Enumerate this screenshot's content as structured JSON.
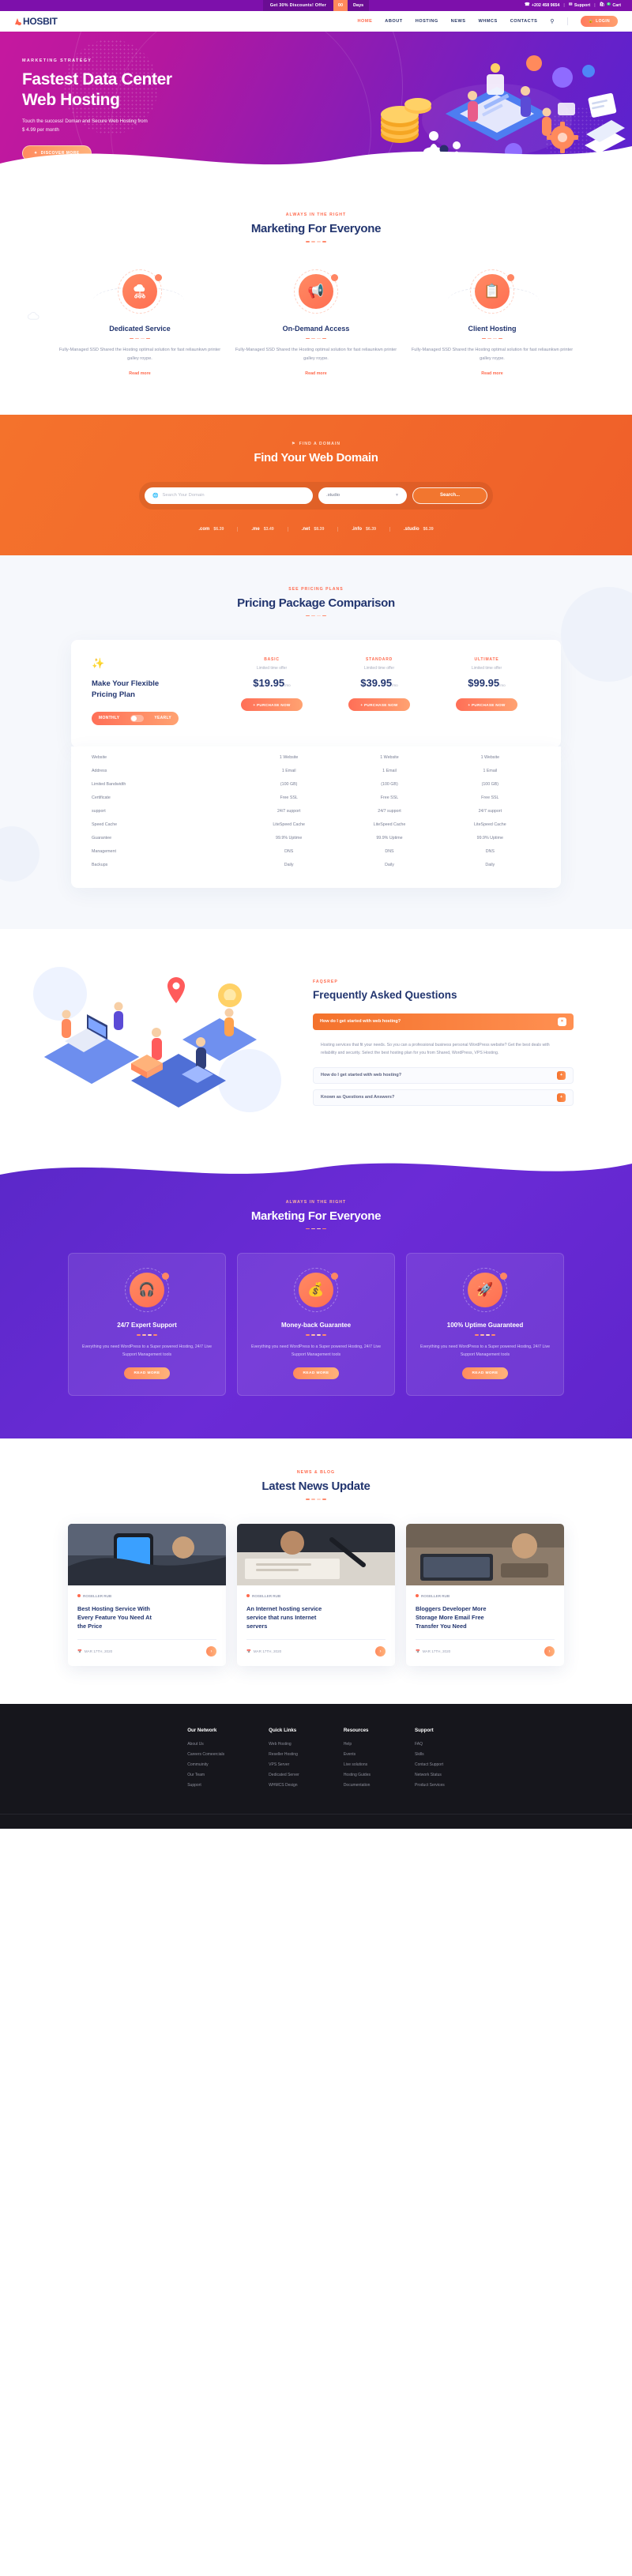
{
  "topbar": {
    "promo": "Get 30% Discounts! Offer",
    "counter": "00",
    "days": "Days",
    "phone": "+202 458 9654",
    "support": "Support",
    "cart": "Cart",
    "cart_count": "0"
  },
  "nav": {
    "logo": "HOSBIT",
    "items": [
      {
        "label": "HOME",
        "active": true
      },
      {
        "label": "ABOUT",
        "active": false
      },
      {
        "label": "HOSTING",
        "active": false
      },
      {
        "label": "NEWS",
        "active": false
      },
      {
        "label": "WHMCS",
        "active": false
      },
      {
        "label": "CONTACTS",
        "active": false
      }
    ],
    "login": "LOGIN"
  },
  "hero": {
    "eyebrow": "MARKETING STRATEGY",
    "title_line1": "Fastest Data Center",
    "title_line2": "Web Hosting",
    "sub_line1": "Touch the success! Doman and Secure Web Hosting from",
    "sub_line2": "$ 4.99 per month",
    "cta": "DISCOVER MORE"
  },
  "services": {
    "eyebrow": "ALWAYS IN THE RIGHT",
    "title": "Marketing For Everyone",
    "items": [
      {
        "icon": "cloud-network-icon",
        "title": "Dedicated Service",
        "text": "Fully-Managed SSD Shared the Hosting optimal solution for fast reliaunkwn printer galley roype.",
        "link": "Read more"
      },
      {
        "icon": "megaphone-icon",
        "title": "On-Demand Access",
        "text": "Fully-Managed SSD Shared the Hosting optimal solution for fast reliaunkwn printer galley roype.",
        "link": "Read more"
      },
      {
        "icon": "clipboard-icon",
        "title": "Client Hosting",
        "text": "Fully-Managed SSD Shared the Hosting optimal solution for fast reliaunkwn printer galley roype.",
        "link": "Read more"
      }
    ]
  },
  "domain": {
    "eyebrow": "FIND A DOMAIN",
    "title": "Find Your Web Domain",
    "search_placeholder": "Search Your Domain",
    "select_value": ".studio",
    "search_button": "Search...",
    "tlds": [
      {
        "name": ".com",
        "price": "$6.39"
      },
      {
        "name": ".me",
        "price": "$3.49"
      },
      {
        "name": ".net",
        "price": "$8.39"
      },
      {
        "name": ".info",
        "price": "$6.39"
      },
      {
        "name": ".studio",
        "price": "$6.39"
      }
    ]
  },
  "pricing": {
    "eyebrow": "SEE PRICING PLANS",
    "title": "Pricing Package Comparison",
    "panel_title_line1": "Make Your Flexible",
    "panel_title_line2": "Pricing Plan",
    "toggle_left": "MONTHLY",
    "toggle_right": "YEARLY",
    "plans": [
      {
        "name": "BASIC",
        "offer": "Limited time offer",
        "price": "$19.95",
        "per": "/mo",
        "cta": "+ PURCHASE NOW"
      },
      {
        "name": "STANDARD",
        "offer": "Limited time offer",
        "price": "$39.95",
        "per": "/mo",
        "cta": "+ PURCHASE NOW"
      },
      {
        "name": "ULTIMATE",
        "offer": "Limited time offer",
        "price": "$99.95",
        "per": "/mo",
        "cta": "+ PURCHASE NOW"
      }
    ],
    "rows": [
      {
        "label": "Website",
        "values": [
          "1 Website",
          "1 Website",
          "1 Website"
        ]
      },
      {
        "label": "Address",
        "values": [
          "1 Email",
          "1 Email",
          "1 Email"
        ]
      },
      {
        "label": "Limited Bandwidth",
        "values": [
          "(100 GB)",
          "(100 GB)",
          "(100 GB)"
        ]
      },
      {
        "label": "Certificate",
        "values": [
          "Free SSL",
          "Free SSL",
          "Free SSL"
        ]
      },
      {
        "label": "support",
        "values": [
          "24/7 support",
          "24/7 support",
          "24/7 support"
        ]
      },
      {
        "label": "Speed Cache",
        "values": [
          "LiteSpeed Cache",
          "LiteSpeed Cache",
          "LiteSpeed Cache"
        ]
      },
      {
        "label": "Guarantee",
        "values": [
          "99.9% Uptime",
          "99.9% Uptime",
          "99.9% Uptime"
        ]
      },
      {
        "label": "Management",
        "values": [
          "DNS",
          "DNS",
          "DNS"
        ]
      },
      {
        "label": "Backups",
        "values": [
          "Daily",
          "Daily",
          "Daily"
        ]
      }
    ]
  },
  "faq": {
    "eyebrow": "FAQSREP",
    "title": "Frequently Asked Questions",
    "items": [
      {
        "question": "How do I get started with web hosting?",
        "open": true,
        "answer": "Hosting services that fit your needs. So you can a professional business personal WordPress website? Get the best deals with reliability and security. Select the best hosting plan for you from Shared, WordPress, VPS Hosting."
      },
      {
        "question": "How do I get started with web hosting?",
        "open": false,
        "answer": ""
      },
      {
        "question": "Known as Questions and Answers?",
        "open": false,
        "answer": ""
      }
    ]
  },
  "purple": {
    "eyebrow": "ALWAYS IN THE RIGHT",
    "title": "Marketing For Everyone",
    "cards": [
      {
        "icon": "headset-icon",
        "title": "24/7 Expert Support",
        "text": "Everything you need WordPress to a Super powered Hosting, 24/7 Live Support Management tools",
        "cta": "READ MORE"
      },
      {
        "icon": "shield-money-icon",
        "title": "Money-back Guarantee",
        "text": "Everything you need WordPress to a Super powered Hosting, 24/7 Live Support Management tools",
        "cta": "READ MORE"
      },
      {
        "icon": "rocket-icon",
        "title": "100% Uptime Guaranteed",
        "text": "Everything you need WordPress to a Super powered Hosting, 24/7 Live Support Management tools",
        "cta": "READ MORE"
      }
    ]
  },
  "blog": {
    "eyebrow": "NEWS & BLOG",
    "title": "Latest News Update",
    "posts": [
      {
        "author": "ROSELLER RUB",
        "title_line1": "Best Hosting Service With",
        "title_line2": "Every Feature You Need At",
        "title_line3": "the Price",
        "date": "MAR 17TH, 2020",
        "arrow": "›"
      },
      {
        "author": "ROSELLER RUB",
        "title_line1": "An Internet hosting service",
        "title_line2": "service that runs Internet",
        "title_line3": "servers",
        "date": "MAR 17TH, 2020",
        "arrow": "›"
      },
      {
        "author": "ROSELLER RUB",
        "title_line1": "Bloggers Developer More",
        "title_line2": "Storage More Email Free",
        "title_line3": "Transfer You Need",
        "date": "MAR 17TH, 2020",
        "arrow": "›"
      }
    ]
  },
  "footer": {
    "columns": [
      {
        "heading": "Our Network",
        "links": [
          "About Us",
          "Careers Comeercials",
          "Commuinity",
          "Our Team",
          "Support"
        ]
      },
      {
        "heading": "Quick Links",
        "links": [
          "Web Hosting",
          "Reseller Hosting",
          "VPS Server",
          "Dedicated Server",
          "WHMCS Design"
        ]
      },
      {
        "heading": "Resources",
        "links": [
          "Help",
          "Events",
          "Live solutions",
          "Hosting Guides",
          "Documentation"
        ]
      },
      {
        "heading": "Support",
        "links": [
          "FAQ",
          "Skills",
          "Contact Support",
          "Network Status",
          "Product Services"
        ]
      }
    ]
  },
  "colors": {
    "accent": "#ff6a4d",
    "orange": "#f4722c",
    "navy": "#22356f",
    "purple": "#6b2bd6",
    "magenta": "#c5189f"
  }
}
